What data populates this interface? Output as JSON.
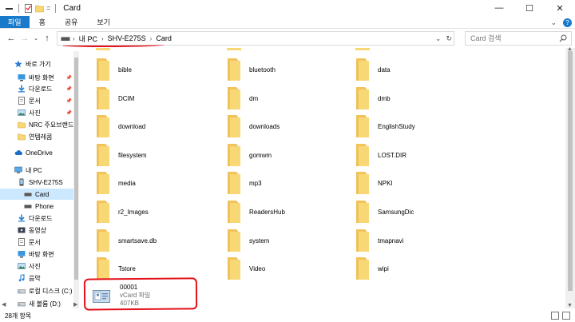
{
  "window": {
    "title": "Card",
    "controls": [
      "—",
      "☐",
      "✕"
    ]
  },
  "ribbon": {
    "tabs": [
      {
        "label": "파일",
        "active": true
      },
      {
        "label": "홈",
        "active": false
      },
      {
        "label": "공유",
        "active": false
      },
      {
        "label": "보기",
        "active": false
      }
    ]
  },
  "address": {
    "crumbs": [
      "내 PC",
      "SHV-E275S",
      "Card"
    ],
    "search_placeholder": "Card 검색"
  },
  "sidebar": {
    "items": [
      {
        "label": "바로 가기",
        "icon": "star-icon",
        "indent": 1,
        "pinned": false
      },
      {
        "label": "바탕 화면",
        "icon": "desktop-icon",
        "indent": 2,
        "pinned": true
      },
      {
        "label": "다운로드",
        "icon": "download-icon",
        "indent": 2,
        "pinned": true
      },
      {
        "label": "문서",
        "icon": "document-icon",
        "indent": 2,
        "pinned": true
      },
      {
        "label": "사진",
        "icon": "picture-icon",
        "indent": 2,
        "pinned": true
      },
      {
        "label": "NRC 주요브랜드",
        "icon": "folder-icon",
        "indent": 2,
        "pinned": false
      },
      {
        "label": "연템레콤",
        "icon": "folder-icon",
        "indent": 2,
        "pinned": false
      },
      {
        "label": "OneDrive",
        "icon": "cloud-icon",
        "indent": 1,
        "pinned": false
      },
      {
        "label": "내 PC",
        "icon": "computer-icon",
        "indent": 1,
        "pinned": false
      },
      {
        "label": "SHV-E275S",
        "icon": "phone-icon",
        "indent": 2,
        "pinned": false
      },
      {
        "label": "Card",
        "icon": "drive-icon",
        "indent": 3,
        "pinned": false,
        "selected": true
      },
      {
        "label": "Phone",
        "icon": "drive-icon",
        "indent": 3,
        "pinned": false
      },
      {
        "label": "다운로드",
        "icon": "download-icon",
        "indent": 2,
        "pinned": false
      },
      {
        "label": "동영상",
        "icon": "video-icon",
        "indent": 2,
        "pinned": false
      },
      {
        "label": "문서",
        "icon": "document-icon",
        "indent": 2,
        "pinned": false
      },
      {
        "label": "바탕 화면",
        "icon": "desktop-icon",
        "indent": 2,
        "pinned": false
      },
      {
        "label": "사진",
        "icon": "picture-icon",
        "indent": 2,
        "pinned": false
      },
      {
        "label": "음악",
        "icon": "music-icon",
        "indent": 2,
        "pinned": false
      },
      {
        "label": "로컬 디스크 (C:)",
        "icon": "disk-icon",
        "indent": 2,
        "pinned": false
      },
      {
        "label": "새 볼륨 (D:)",
        "icon": "disk-icon",
        "indent": 2,
        "pinned": false
      }
    ]
  },
  "files": {
    "folders": [
      "bible",
      "bluetooth",
      "data",
      "DCIM",
      "dm",
      "dmb",
      "download",
      "downloads",
      "EnglishStudy",
      "filesystem",
      "gomwm",
      "LOST.DIR",
      "media",
      "mp3",
      "NPKI",
      "r2_Images",
      "ReadersHub",
      "SamsungDic",
      "smartsave.db",
      "system",
      "tmapnavi",
      "Tstore",
      "Video",
      "wipi"
    ],
    "vcard": {
      "name": "00001",
      "type": "vCard 파일",
      "size": "407KB"
    }
  },
  "status": {
    "text": "28개 항목"
  },
  "colors": {
    "accent": "#1979ca",
    "annotation": "#e3111b",
    "folder": "#f8d775",
    "selected": "#cce8ff"
  }
}
